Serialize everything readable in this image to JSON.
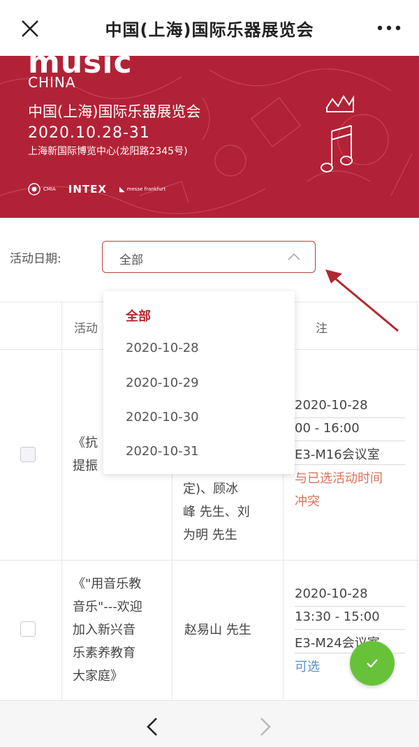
{
  "nav": {
    "title": "中国(上海)国际乐器展览会",
    "close_icon": "close-icon",
    "more_icon": "more-icon"
  },
  "banner": {
    "brand": "music",
    "brand_sub": "CHINA",
    "expo_name": "中国(上海)国际乐器展览会",
    "dates": "2020.10.28-31",
    "venue": "上海新国际博览中心(龙阳路2345号)",
    "logos": [
      "CMIA",
      "INTEX",
      "messe frankfurt"
    ],
    "color": "#b22236"
  },
  "filter": {
    "label": "活动日期:",
    "selected": "全部"
  },
  "dropdown": {
    "options": [
      "全部",
      "2020-10-28",
      "2020-10-29",
      "2020-10-30",
      "2020-10-31"
    ],
    "selected_index": 0
  },
  "table": {
    "headers": [
      "活动",
      "注"
    ],
    "rows": [
      {
        "activity_lines": [
          "《抗",
          "提振"
        ],
        "speaker_lines": [
          "定)、顾冰",
          "峰 先生、刘",
          "为明 先生"
        ],
        "date": "2020-10-28",
        "time": "00 - 16:00",
        "room": "E3-M16会议室",
        "status_lines": [
          "与已选活动时间",
          "冲突"
        ],
        "checked": false
      },
      {
        "activity_lines": [
          "《\"用音乐教",
          "音乐\"---欢迎",
          "加入新兴音",
          "乐素养教育",
          "大家庭》"
        ],
        "speaker": "赵易山 先生",
        "date": "2020-10-28",
        "time": "13:30 - 15:00",
        "room": "E3-M24会议室",
        "status": "可选",
        "checked": false
      }
    ]
  },
  "colors": {
    "accent": "#b3272f",
    "conflict": "#d9735c",
    "available": "#5b8fd0",
    "fab": "#67c23a"
  }
}
